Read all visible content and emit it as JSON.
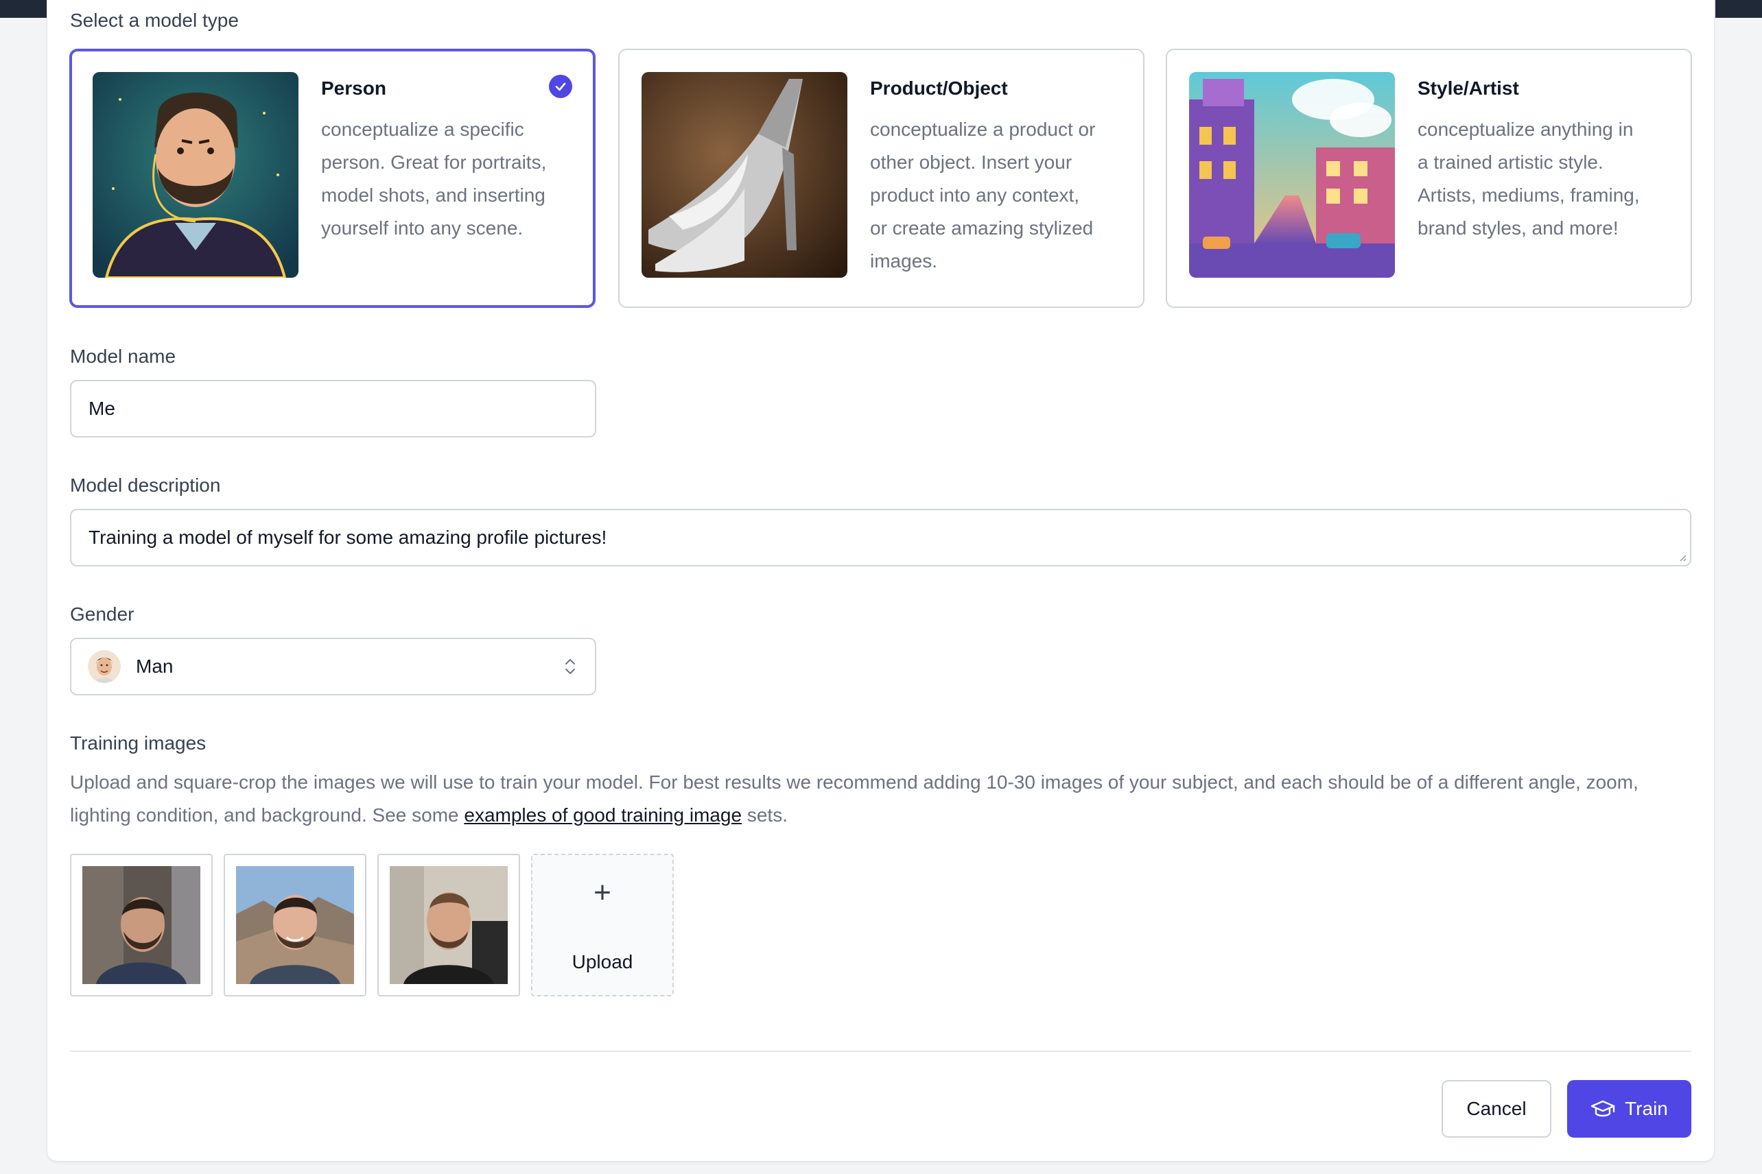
{
  "form": {
    "model_type_label": "Select a model type",
    "model_types": [
      {
        "title": "Person",
        "description": "conceptualize a specific person. Great for portraits, model shots, and inserting yourself into any scene.",
        "selected": true,
        "thumb_icon": "portrait-illustration"
      },
      {
        "title": "Product/Object",
        "description": "conceptualize a product or other object. Insert your product into any context, or create amazing stylized images.",
        "selected": false,
        "thumb_icon": "high-heel-shoes-photo"
      },
      {
        "title": "Style/Artist",
        "description": "conceptualize anything in a trained artistic style. Artists, mediums, framing, brand styles, and more!",
        "selected": false,
        "thumb_icon": "cartoon-city-street"
      }
    ],
    "model_name_label": "Model name",
    "model_name_value": "Me",
    "model_description_label": "Model description",
    "model_description_value": "Training a model of myself for some amazing profile pictures!",
    "gender_label": "Gender",
    "gender_value": "Man",
    "training_images_label": "Training images",
    "training_help_before": "Upload and square-crop the images we will use to train your model. For best results we recommend adding 10-30 images of your subject, and each should be of a different angle, zoom, lighting condition, and background. See some ",
    "training_help_link": "examples of good training image",
    "training_help_after": " sets.",
    "upload_label": "Upload",
    "cancel_label": "Cancel",
    "train_label": "Train"
  },
  "colors": {
    "accent": "#4f46e5",
    "border": "#d1d5db",
    "muted_text": "#6b7280",
    "background": "#f3f4f6"
  }
}
